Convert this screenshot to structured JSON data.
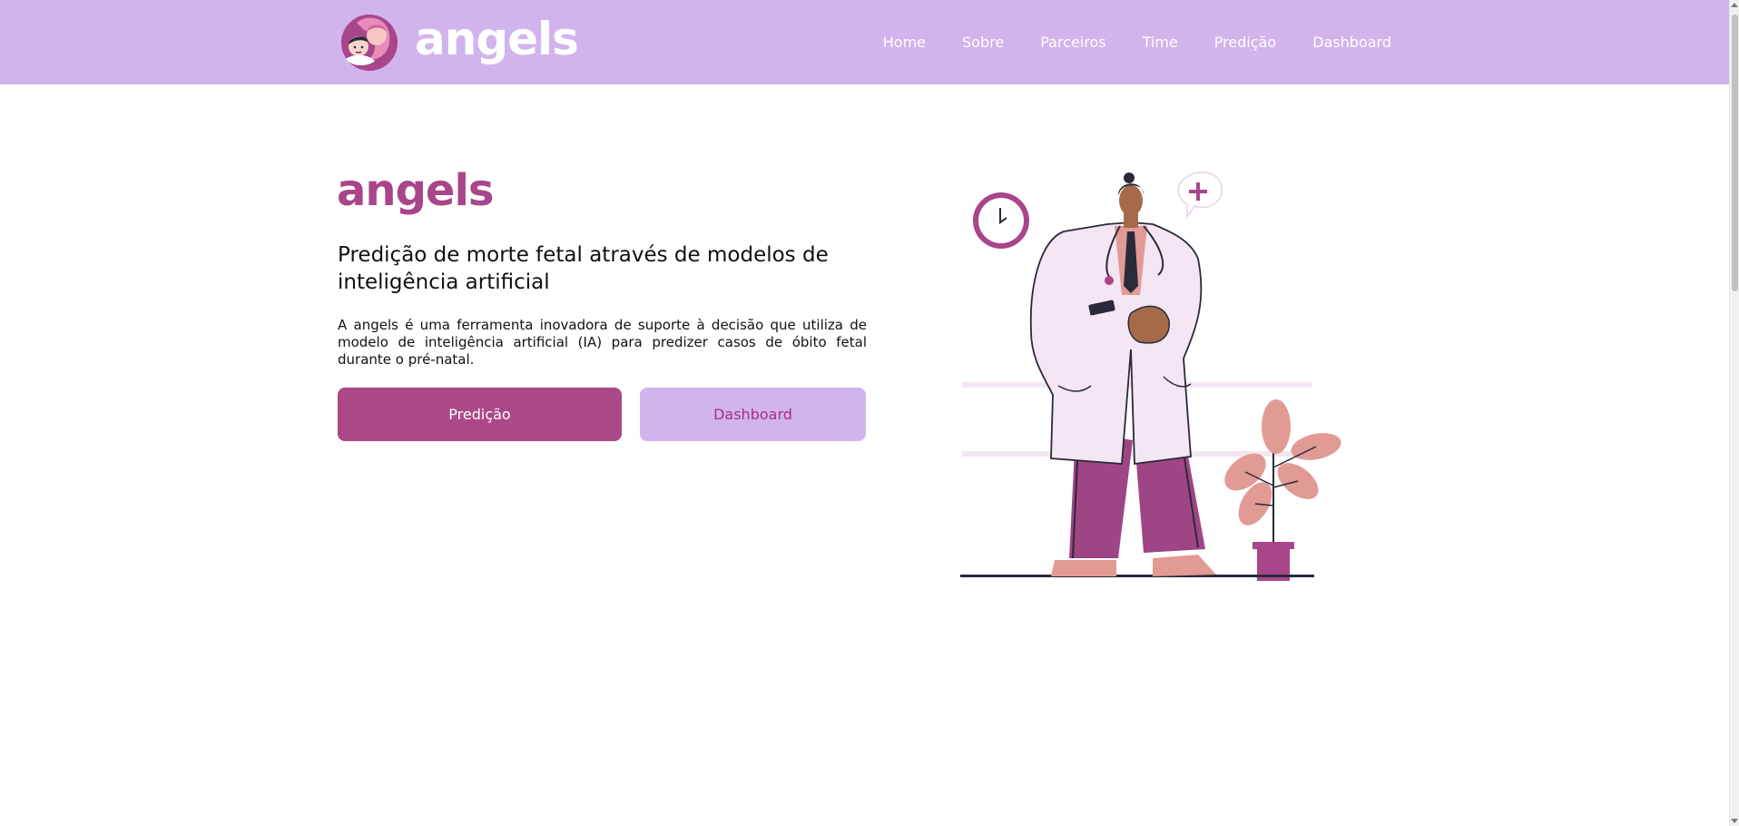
{
  "header": {
    "brand_name": "angels",
    "nav": [
      "Home",
      "Sobre",
      "Parceiros",
      "Time",
      "Predição",
      "Dashboard"
    ]
  },
  "hero": {
    "title": "angels",
    "subtitle": "Predição de morte fetal através de modelos de inteligência artificial",
    "description": "A angels é uma ferramenta inovadora de suporte à decisão que utiliza de modelo de inteligência artificial (IA) para predizer casos de óbito fetal durante o pré-natal.",
    "primary_button": "Predição",
    "secondary_button": "Dashboard"
  },
  "icons": {
    "logo": "mother-and-baby-logo",
    "illustration": "doctor-illustration"
  },
  "colors": {
    "navbar": "#d2b4ec",
    "accent": "#ab4888",
    "button_secondary_text": "#a6307e"
  }
}
